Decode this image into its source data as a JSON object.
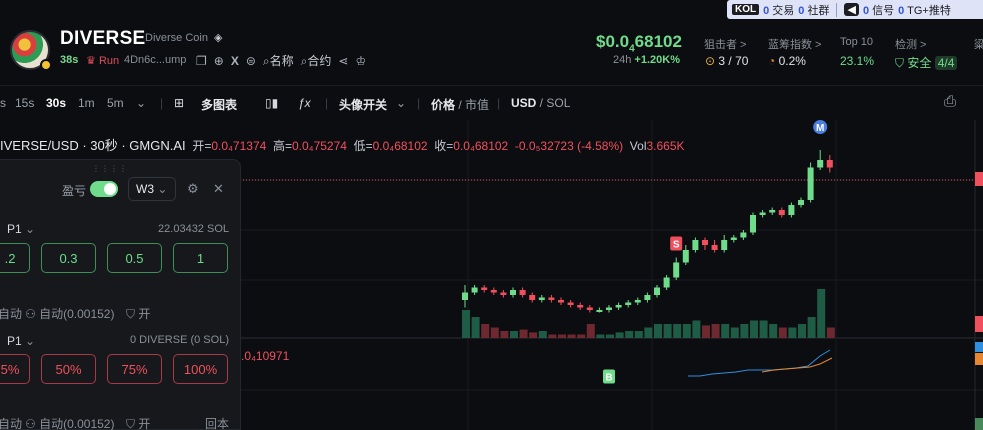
{
  "header": {
    "token_name": "DIVERSE",
    "token_fullname": "Diverse Coin",
    "age": "38s",
    "run_label": "Run",
    "address": "4Dn6c...ump",
    "name_search": "名称",
    "contract_search": "合约",
    "price_prefix": "$0.0",
    "price_sub": "4",
    "price_suffix": "68102",
    "change_label": "24h",
    "change_value": "+1.20K%",
    "stats": [
      {
        "label": "狙击者 >",
        "value": "3 / 70"
      },
      {
        "label": "蓝筹指数 >",
        "value": "0.2%"
      },
      {
        "label": "Top 10",
        "value": "23.1%"
      },
      {
        "label": "检测 >",
        "value_label": "安全",
        "value": "4/4"
      },
      {
        "label": "粱",
        "value": ""
      }
    ]
  },
  "notif": {
    "kol": "KOL",
    "trade_count": "0",
    "trade_label": "交易",
    "community_count": "0",
    "community_label": "社群",
    "signal_count": "0",
    "signal_label": "信号",
    "tg_count": "0",
    "tg_label": "TG+推特"
  },
  "toolbar": {
    "intervals": [
      "s",
      "15s",
      "30s",
      "1m",
      "5m"
    ],
    "active_interval": "30s",
    "multi_chart": "多图表",
    "avatar_toggle": "头像开关",
    "price_label": "价格",
    "mcap_label": "市值",
    "usd_label": "USD",
    "sol_label": "SOL"
  },
  "chart_info": {
    "pair": "IVERSE/USD · 30秒 · GMGN.AI",
    "open_label": "开=",
    "open_value": "0.0₄71374",
    "high_label": "高=",
    "high_value": "0.0₄75274",
    "low_label": "低=",
    "low_value": "0.0₄68102",
    "close_label": "收=",
    "close_value": "0.0₄68102",
    "change": "-0.0₅32723 (-4.58%)",
    "vol_label": "Vol",
    "vol_value": "3.665K",
    "indicator_value": ".0₄10971"
  },
  "panel": {
    "pnl_label": "盈亏",
    "wallet": "W3",
    "buy_preset": "P1",
    "balance": "22.03432 SOL",
    "buy_amounts": [
      ".2",
      "0.3",
      "0.5",
      "1"
    ],
    "auto_label": "自动(0.00152)",
    "auto_prefix": "自动",
    "open_label": "开",
    "sell_preset": "P1",
    "sell_balance": "0 DIVERSE (0  SOL)",
    "sell_amounts": [
      "5%",
      "50%",
      "75%",
      "100%"
    ],
    "back_label": "回本"
  },
  "chart_data": {
    "type": "candlestick",
    "candles": [
      {
        "o": 0.4,
        "c": 0.43,
        "h": 0.46,
        "l": 0.37
      },
      {
        "o": 0.43,
        "c": 0.45,
        "h": 0.46,
        "l": 0.42
      },
      {
        "o": 0.45,
        "c": 0.44,
        "h": 0.46,
        "l": 0.43
      },
      {
        "o": 0.44,
        "c": 0.43,
        "h": 0.45,
        "l": 0.42
      },
      {
        "o": 0.43,
        "c": 0.42,
        "h": 0.44,
        "l": 0.41
      },
      {
        "o": 0.42,
        "c": 0.44,
        "h": 0.45,
        "l": 0.41
      },
      {
        "o": 0.44,
        "c": 0.42,
        "h": 0.45,
        "l": 0.41
      },
      {
        "o": 0.42,
        "c": 0.4,
        "h": 0.43,
        "l": 0.39
      },
      {
        "o": 0.4,
        "c": 0.41,
        "h": 0.42,
        "l": 0.39
      },
      {
        "o": 0.41,
        "c": 0.4,
        "h": 0.42,
        "l": 0.39
      },
      {
        "o": 0.4,
        "c": 0.39,
        "h": 0.41,
        "l": 0.38
      },
      {
        "o": 0.39,
        "c": 0.38,
        "h": 0.4,
        "l": 0.37
      },
      {
        "o": 0.38,
        "c": 0.37,
        "h": 0.39,
        "l": 0.36
      },
      {
        "o": 0.37,
        "c": 0.36,
        "h": 0.38,
        "l": 0.35
      },
      {
        "o": 0.36,
        "c": 0.36,
        "h": 0.37,
        "l": 0.35
      },
      {
        "o": 0.36,
        "c": 0.37,
        "h": 0.38,
        "l": 0.35
      },
      {
        "o": 0.37,
        "c": 0.38,
        "h": 0.39,
        "l": 0.36
      },
      {
        "o": 0.38,
        "c": 0.39,
        "h": 0.4,
        "l": 0.37
      },
      {
        "o": 0.39,
        "c": 0.4,
        "h": 0.41,
        "l": 0.38
      },
      {
        "o": 0.4,
        "c": 0.42,
        "h": 0.43,
        "l": 0.39
      },
      {
        "o": 0.42,
        "c": 0.45,
        "h": 0.46,
        "l": 0.41
      },
      {
        "o": 0.45,
        "c": 0.49,
        "h": 0.5,
        "l": 0.44
      },
      {
        "o": 0.49,
        "c": 0.55,
        "h": 0.57,
        "l": 0.48
      },
      {
        "o": 0.55,
        "c": 0.6,
        "h": 0.62,
        "l": 0.54
      },
      {
        "o": 0.6,
        "c": 0.64,
        "h": 0.65,
        "l": 0.59
      },
      {
        "o": 0.64,
        "c": 0.62,
        "h": 0.65,
        "l": 0.6
      },
      {
        "o": 0.62,
        "c": 0.6,
        "h": 0.64,
        "l": 0.59
      },
      {
        "o": 0.6,
        "c": 0.64,
        "h": 0.66,
        "l": 0.59
      },
      {
        "o": 0.64,
        "c": 0.65,
        "h": 0.66,
        "l": 0.63
      },
      {
        "o": 0.65,
        "c": 0.67,
        "h": 0.68,
        "l": 0.64
      },
      {
        "o": 0.67,
        "c": 0.74,
        "h": 0.75,
        "l": 0.66
      },
      {
        "o": 0.74,
        "c": 0.75,
        "h": 0.76,
        "l": 0.73
      },
      {
        "o": 0.75,
        "c": 0.76,
        "h": 0.77,
        "l": 0.74
      },
      {
        "o": 0.76,
        "c": 0.74,
        "h": 0.77,
        "l": 0.73
      },
      {
        "o": 0.74,
        "c": 0.78,
        "h": 0.79,
        "l": 0.73
      },
      {
        "o": 0.78,
        "c": 0.8,
        "h": 0.81,
        "l": 0.77
      },
      {
        "o": 0.8,
        "c": 0.93,
        "h": 0.95,
        "l": 0.79
      },
      {
        "o": 0.93,
        "c": 0.96,
        "h": 1.0,
        "l": 0.92
      },
      {
        "o": 0.96,
        "c": 0.93,
        "h": 0.98,
        "l": 0.91
      }
    ],
    "volumes": [
      0.4,
      0.3,
      0.2,
      0.15,
      0.1,
      0.1,
      0.12,
      0.08,
      0.1,
      0.05,
      0.05,
      0.05,
      0.05,
      0.2,
      0.05,
      0.05,
      0.08,
      0.1,
      0.1,
      0.15,
      0.2,
      0.2,
      0.2,
      0.2,
      0.25,
      0.18,
      0.2,
      0.2,
      0.15,
      0.2,
      0.25,
      0.25,
      0.2,
      0.15,
      0.15,
      0.2,
      0.3,
      0.7,
      0.15
    ],
    "markers": [
      {
        "label": "S",
        "index": 22,
        "color": "#f0505e"
      },
      {
        "label": "B",
        "index": 15,
        "color": "#6fdc8c"
      },
      {
        "label": "M",
        "index": 37,
        "color": "#4a7ee0"
      }
    ],
    "colors": {
      "up": "#6fdc8c",
      "down": "#f0505e",
      "ma1": "#2f8fe0",
      "ma2": "#e8862f"
    }
  }
}
